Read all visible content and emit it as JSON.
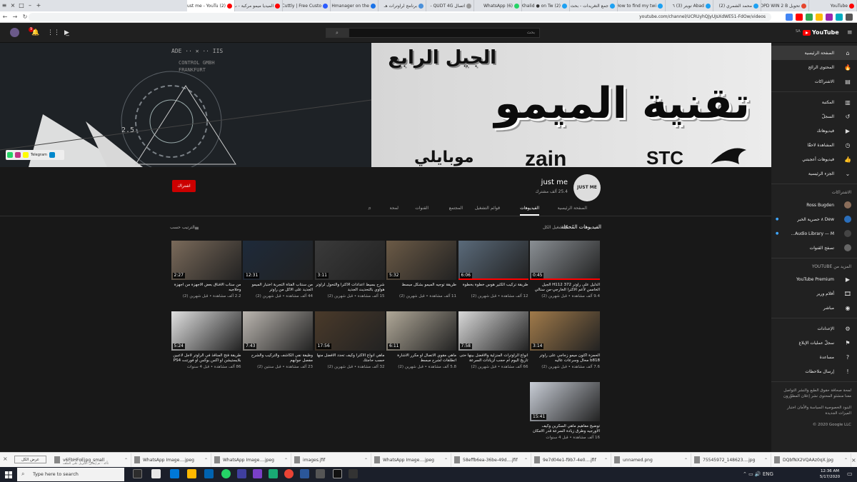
{
  "browser": {
    "tabs": [
      {
        "label": "YouTube",
        "color": "#ff0000"
      },
      {
        "label": "تحويل OPD WIN 2 B",
        "color": "#e6462d"
      },
      {
        "label": "محمد الشمري (2)",
        "color": "#1da1f2"
      },
      {
        "label": "Abad تويتر (3) ٦",
        "color": "#1da1f2"
      },
      {
        "label": "How to find my twi",
        "color": "#1da1f2"
      },
      {
        "label": "جمع التغريدات - بحث",
        "color": "#1da1f2"
      },
      {
        "label": "Khalid ● on Tw (2)",
        "color": "#1da1f2"
      },
      {
        "label": "WhatsApp (6)",
        "color": "#25d366"
      },
      {
        "label": "اتصال QUDT 4G -",
        "color": "#999999"
      },
      {
        "label": "برنامج لراوترات هـ",
        "color": "#4a90d9"
      },
      {
        "label": "Hmanager on the",
        "color": "#1a73e8"
      },
      {
        "label": "Cuttly | Free Custo",
        "color": "#2b5cff"
      },
      {
        "label": "الميديا ميمو مركبة - ب",
        "color": "#ff0000"
      },
      {
        "label": "(2) just me - YouTu",
        "color": "#ff0000"
      }
    ],
    "url": "youtube.com/channel/UCRUyhQJyUJsXdWE51-FdOw/videos"
  },
  "youtube": {
    "logo": "YouTube",
    "region": "SA",
    "search_placeholder": "بحث",
    "notif_count": "9"
  },
  "sidebar": {
    "main": [
      {
        "label": "الصفحة الرئيسية",
        "icon": "home-icon",
        "glyph": "⌂",
        "active": true
      },
      {
        "label": "المحتوى الرائج",
        "icon": "flame-icon",
        "glyph": "🔥"
      },
      {
        "label": "الاشتراكات",
        "icon": "subscriptions-icon",
        "glyph": "▤"
      }
    ],
    "library": [
      {
        "label": "المكتبة",
        "icon": "library-icon",
        "glyph": "▥"
      },
      {
        "label": "السجلّ",
        "icon": "history-icon",
        "glyph": "↺"
      },
      {
        "label": "فيديوهاتك",
        "icon": "your-videos-icon",
        "glyph": "▶"
      },
      {
        "label": "المشاهدة لاحقًا",
        "icon": "watch-later-icon",
        "glyph": "◷"
      },
      {
        "label": "فيديوهات أعجبتني",
        "icon": "liked-icon",
        "glyph": "👍"
      },
      {
        "label": "الجزء الرئيسية",
        "icon": "chevron-down-icon",
        "glyph": "⌄"
      }
    ],
    "subs_heading": "الاشتراكات",
    "subs": [
      {
        "label": "Ross Bugden",
        "color": "#8a6d5a"
      },
      {
        "label": "Dew ٨ حصرية الخبر",
        "color": "#2a6ebb",
        "badge": "●"
      },
      {
        "label": "Audio Library — M...",
        "color": "#444",
        "badge": "●"
      },
      {
        "label": "تصفح القنوات",
        "color": "#666"
      }
    ],
    "more_heading": "المزيد من YOUTUBE",
    "more": [
      {
        "label": "YouTube Premium",
        "icon": "yt-premium-icon",
        "glyph": "▶"
      },
      {
        "label": "أفلام ورير",
        "icon": "movies-icon",
        "glyph": "🎞"
      },
      {
        "label": "مباشر",
        "icon": "live-icon",
        "glyph": "◉"
      }
    ],
    "settings": [
      {
        "label": "الإعدادات",
        "icon": "gear-icon",
        "glyph": "⚙"
      },
      {
        "label": "سجلّ عمليات الإبلاغ",
        "icon": "flag-icon",
        "glyph": "⚑"
      },
      {
        "label": "مساعدة",
        "icon": "help-icon",
        "glyph": "?"
      },
      {
        "label": "إرسال ملاحظات",
        "icon": "feedback-icon",
        "glyph": "!"
      }
    ],
    "footer1": "لمحة  صحافة  حقوق الطبع والنشر  التواصل معنا  منشئو المحتوى  نشر إعلان  المطوّرون",
    "footer2": "البنود  الخصوصية  السياسة والأمان  اختبار الميزات الجديدة",
    "copyright": "© 2020 Google LLC"
  },
  "banner": {
    "line1": "الجيل الرابع",
    "line2": "تقنية الميمو",
    "brands": [
      "STC",
      "zain",
      "موبايلي"
    ],
    "telegram": "Telegram",
    "accent": "#e9e9e9"
  },
  "channel": {
    "name": "just me",
    "subscribers": "25.4 ألف مشترك",
    "avatar_text": "JUST ME",
    "subscribe_label": "اشتراك",
    "tabs": [
      "الصفحة الرئيسية",
      "الفيديوهات",
      "قوائم التشغيل",
      "المجتمع",
      "القنوات",
      "لمحة"
    ],
    "active_tab": 1
  },
  "videos_section": {
    "title": "الفيديوهات المُحمّلة",
    "play_all": "▶ تشغيل الكل",
    "sort": "الترتيب حسب"
  },
  "videos": [
    {
      "title": "الدليل على راوتر H112 372 الجيل الخامس لأعم الاكثرا الخارجي-من ستالي",
      "meta": "9.4 آلف مشاهدة • قبل شهرين (2)",
      "duration": "0:45",
      "progress": 1.0
    },
    {
      "title": "طريقة تركيب الكثير هوس خطوة بخطوة",
      "meta": "12 آلف مشاهدة • قبل شهرين (2)",
      "duration": "6:06",
      "progress": 1.0
    },
    {
      "title": "طريقة توجيه الميمو بشكل مبسط",
      "meta": "11 آلف مشاهدة • قبل شهرين (2)",
      "duration": "5:32",
      "progress": 0.0
    },
    {
      "title": "شرح بسيط اعدادات الاكثرا والتحول لراوتر هواوي بالتحديث الجديد",
      "meta": "15 آلف مشاهدة • قبل شهرين (2)",
      "duration": "3:11",
      "progress": 0.0
    },
    {
      "title": "من سنتاب الفتاة التجربة اختبار الميمو الجديد على الاكل من راوتر",
      "meta": "44 آلف مشاهدة • قبل شهرين (2)",
      "duration": "12:31",
      "progress": 0.0
    },
    {
      "title": "من ستاب الافناق بعض الاجهزة من اجهزة وخلاجيه",
      "meta": "2.2 آلف مشاهدة • قبل شهرين (2)",
      "duration": "2:27",
      "progress": 0.0
    },
    {
      "title": "الحمزة اكثون ميمو زجاجي على راوتر b818 محال وسرعات عاليه",
      "meta": "7.6 آلف مشاهدة • قبل شهرين (2)",
      "duration": "3:14",
      "progress": 0.0
    },
    {
      "title": "انواع الراوترات المنزلية والافضل بينها حتى تاريخ اليوم ام حجب لزيادات السرعة",
      "meta": "66 آلف مشاهدة • قبل شهرين (2)",
      "duration": "7:58",
      "progress": 0.0
    },
    {
      "title": "ماهي مقوي الاتصال او مكرر الاشارة اتطلقات لشرح مبسط",
      "meta": "5.8 آلف مشاهدة • قبل شهرين (2)",
      "duration": "6:11",
      "progress": 0.0
    },
    {
      "title": "ماهي انواع الاكثرا وكيف تحدد الافضل منها حسب حاجتك",
      "meta": "32 آلف مشاهدة • قبل شهرين (2)",
      "duration": "17:56",
      "progress": 0.0
    },
    {
      "title": "وظيفة نفي الكاشف والتركيب والشرح مفصل جوابهم",
      "meta": "23 آلف مشاهدة • قبل سنتين (2)",
      "duration": "7:43",
      "progress": 0.0
    },
    {
      "title": "طريقة فتح المنافذ في الراوتر لاجل لاعبين بلايستيشن او اكس بوكس او فورتنت PS4",
      "meta": "86 آلف مشاهدة • قبل 4 سنوات",
      "duration": "5:24",
      "progress": 0.0
    },
    {
      "title": "توضيح مفاهيم ماهي السكرين وكيف الاورجيه وطرق زيادة السرعة قدر الامكان",
      "meta": "16 آلف مشاهدة • قبل 4 سنوات",
      "duration": "15:41",
      "progress": 0.0
    }
  ],
  "downloads": {
    "show_all": "عرض الكل",
    "items": [
      "DQbfNX2VQAAz0qX.jpg",
      "75545972_148623....jpg",
      "unnamed.png",
      "9e7d04e1-f9b7-4e0....jfif",
      "58effb6ea-36be-49d....jfif",
      "WhatsApp Image....jpeg",
      "images.jfif",
      "WhatsApp Image....jpeg",
      "WhatsApp Image....jpeg",
      "v6FbHFoEjpg_small"
    ],
    "first_sub": "تأكد - تم إيقاف التنزيل على الملف"
  },
  "taskbar": {
    "search": "Type here to search",
    "time": "12:36 AM",
    "date": "5/17/2020"
  }
}
